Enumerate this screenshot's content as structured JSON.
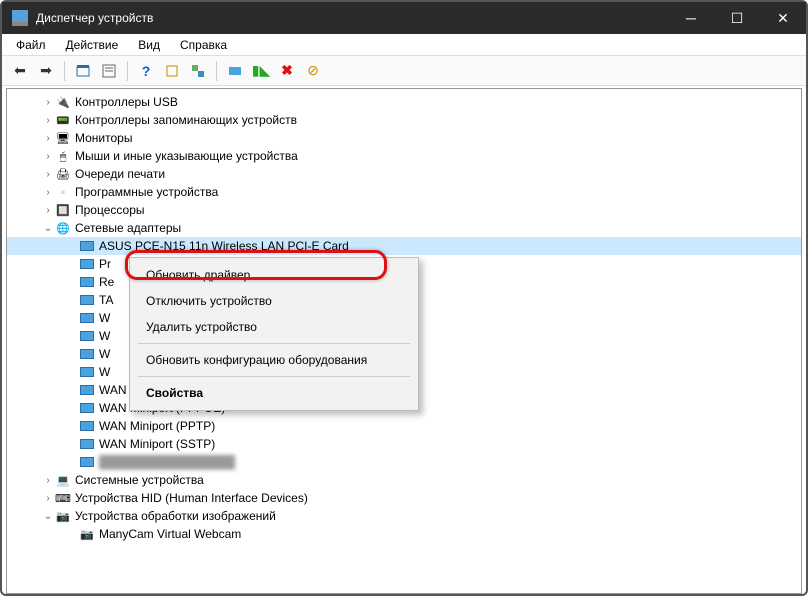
{
  "titlebar": {
    "title": "Диспетчер устройств"
  },
  "menubar": {
    "file": "Файл",
    "action": "Действие",
    "view": "Вид",
    "help": "Справка"
  },
  "tree": {
    "categories": [
      {
        "label": "Контроллеры USB",
        "icon": "usb"
      },
      {
        "label": "Контроллеры запоминающих устройств",
        "icon": "ctrl"
      },
      {
        "label": "Мониторы",
        "icon": "mon"
      },
      {
        "label": "Мыши и иные указывающие устройства",
        "icon": "mouse"
      },
      {
        "label": "Очереди печати",
        "icon": "print"
      },
      {
        "label": "Программные устройства",
        "icon": "sw"
      },
      {
        "label": "Процессоры",
        "icon": "cpu"
      }
    ],
    "network": {
      "label": "Сетевые адаптеры",
      "children": [
        "ASUS PCE-N15 11n Wireless LAN PCI-E Card",
        "Pr",
        "Re",
        "TA",
        "W",
        "W",
        "W",
        "W",
        "WAN Miniport (Network Monitor)",
        "WAN Miniport (PPPOE)",
        "WAN Miniport (PPTP)",
        "WAN Miniport (SSTP)"
      ]
    },
    "after": [
      {
        "label": "Системные устройства",
        "icon": "sys",
        "exp": "›"
      },
      {
        "label": "Устройства HID (Human Interface Devices)",
        "icon": "hid",
        "exp": "›"
      }
    ],
    "imaging": {
      "label": "Устройства обработки изображений",
      "child": "ManyCam Virtual Webcam"
    }
  },
  "context": {
    "update": "Обновить драйвер",
    "disable": "Отключить устройство",
    "remove": "Удалить устройство",
    "scan": "Обновить конфигурацию оборудования",
    "props": "Свойства"
  }
}
